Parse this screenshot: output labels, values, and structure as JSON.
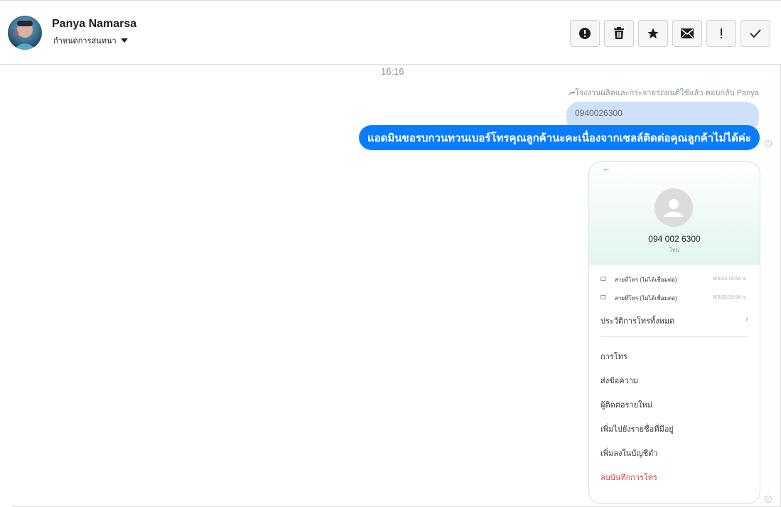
{
  "header": {
    "name": "Panya Namarsa",
    "assign_label": "กำหนดการสนทนา",
    "buttons": [
      {
        "name": "spam-button",
        "icon": "alert-circle-icon"
      },
      {
        "name": "delete-button",
        "icon": "trash-icon"
      },
      {
        "name": "star-button",
        "icon": "star-icon"
      },
      {
        "name": "mark-unread-button",
        "icon": "envelope-icon"
      },
      {
        "name": "follow-up-button",
        "icon": "exclamation-icon"
      },
      {
        "name": "done-button",
        "icon": "check-icon"
      }
    ]
  },
  "conversation": {
    "time": "16:16",
    "reply_note": "โรงงานผลิตและกระจายรถยนต์ใช้แล้ว ตอบกลับ Panya",
    "quoted_text": "0940026300",
    "message": "แอดมินขอรบกวนทวนเบอร์โทรคุณลูกค้านะคะเนื่องจากเซลล์ติดต่อคุณลูกค้าไม่ได้ค่ะ"
  },
  "screenshot": {
    "phone_number": "094 002 6300",
    "number_label": "ใหม่",
    "call_logs": [
      {
        "label": "สายที่โทร (ไม่ได้เชื่อมต่อ)",
        "date": "6/3/23 15:54 น."
      },
      {
        "label": "สายที่โทร (ไม่ได้เชื่อมต่อ)",
        "date": "6/3/23 15:54 น."
      }
    ],
    "all_history": "ประวัติการโทรทั้งหมด",
    "actions": [
      "การโทร",
      "ส่งข้อความ",
      "ผู้ติดต่อรายใหม่",
      "เพิ่มไปยังรายชื่อที่มีอยู่",
      "เพิ่มลงในบัญชีดำ",
      "ลบบันทึกการโทร"
    ]
  },
  "colors": {
    "bubble": "#0a7cff",
    "quote_bg": "#cfe1fa",
    "accent_green": "#3ccf8e",
    "delete_red": "#d9434d"
  }
}
